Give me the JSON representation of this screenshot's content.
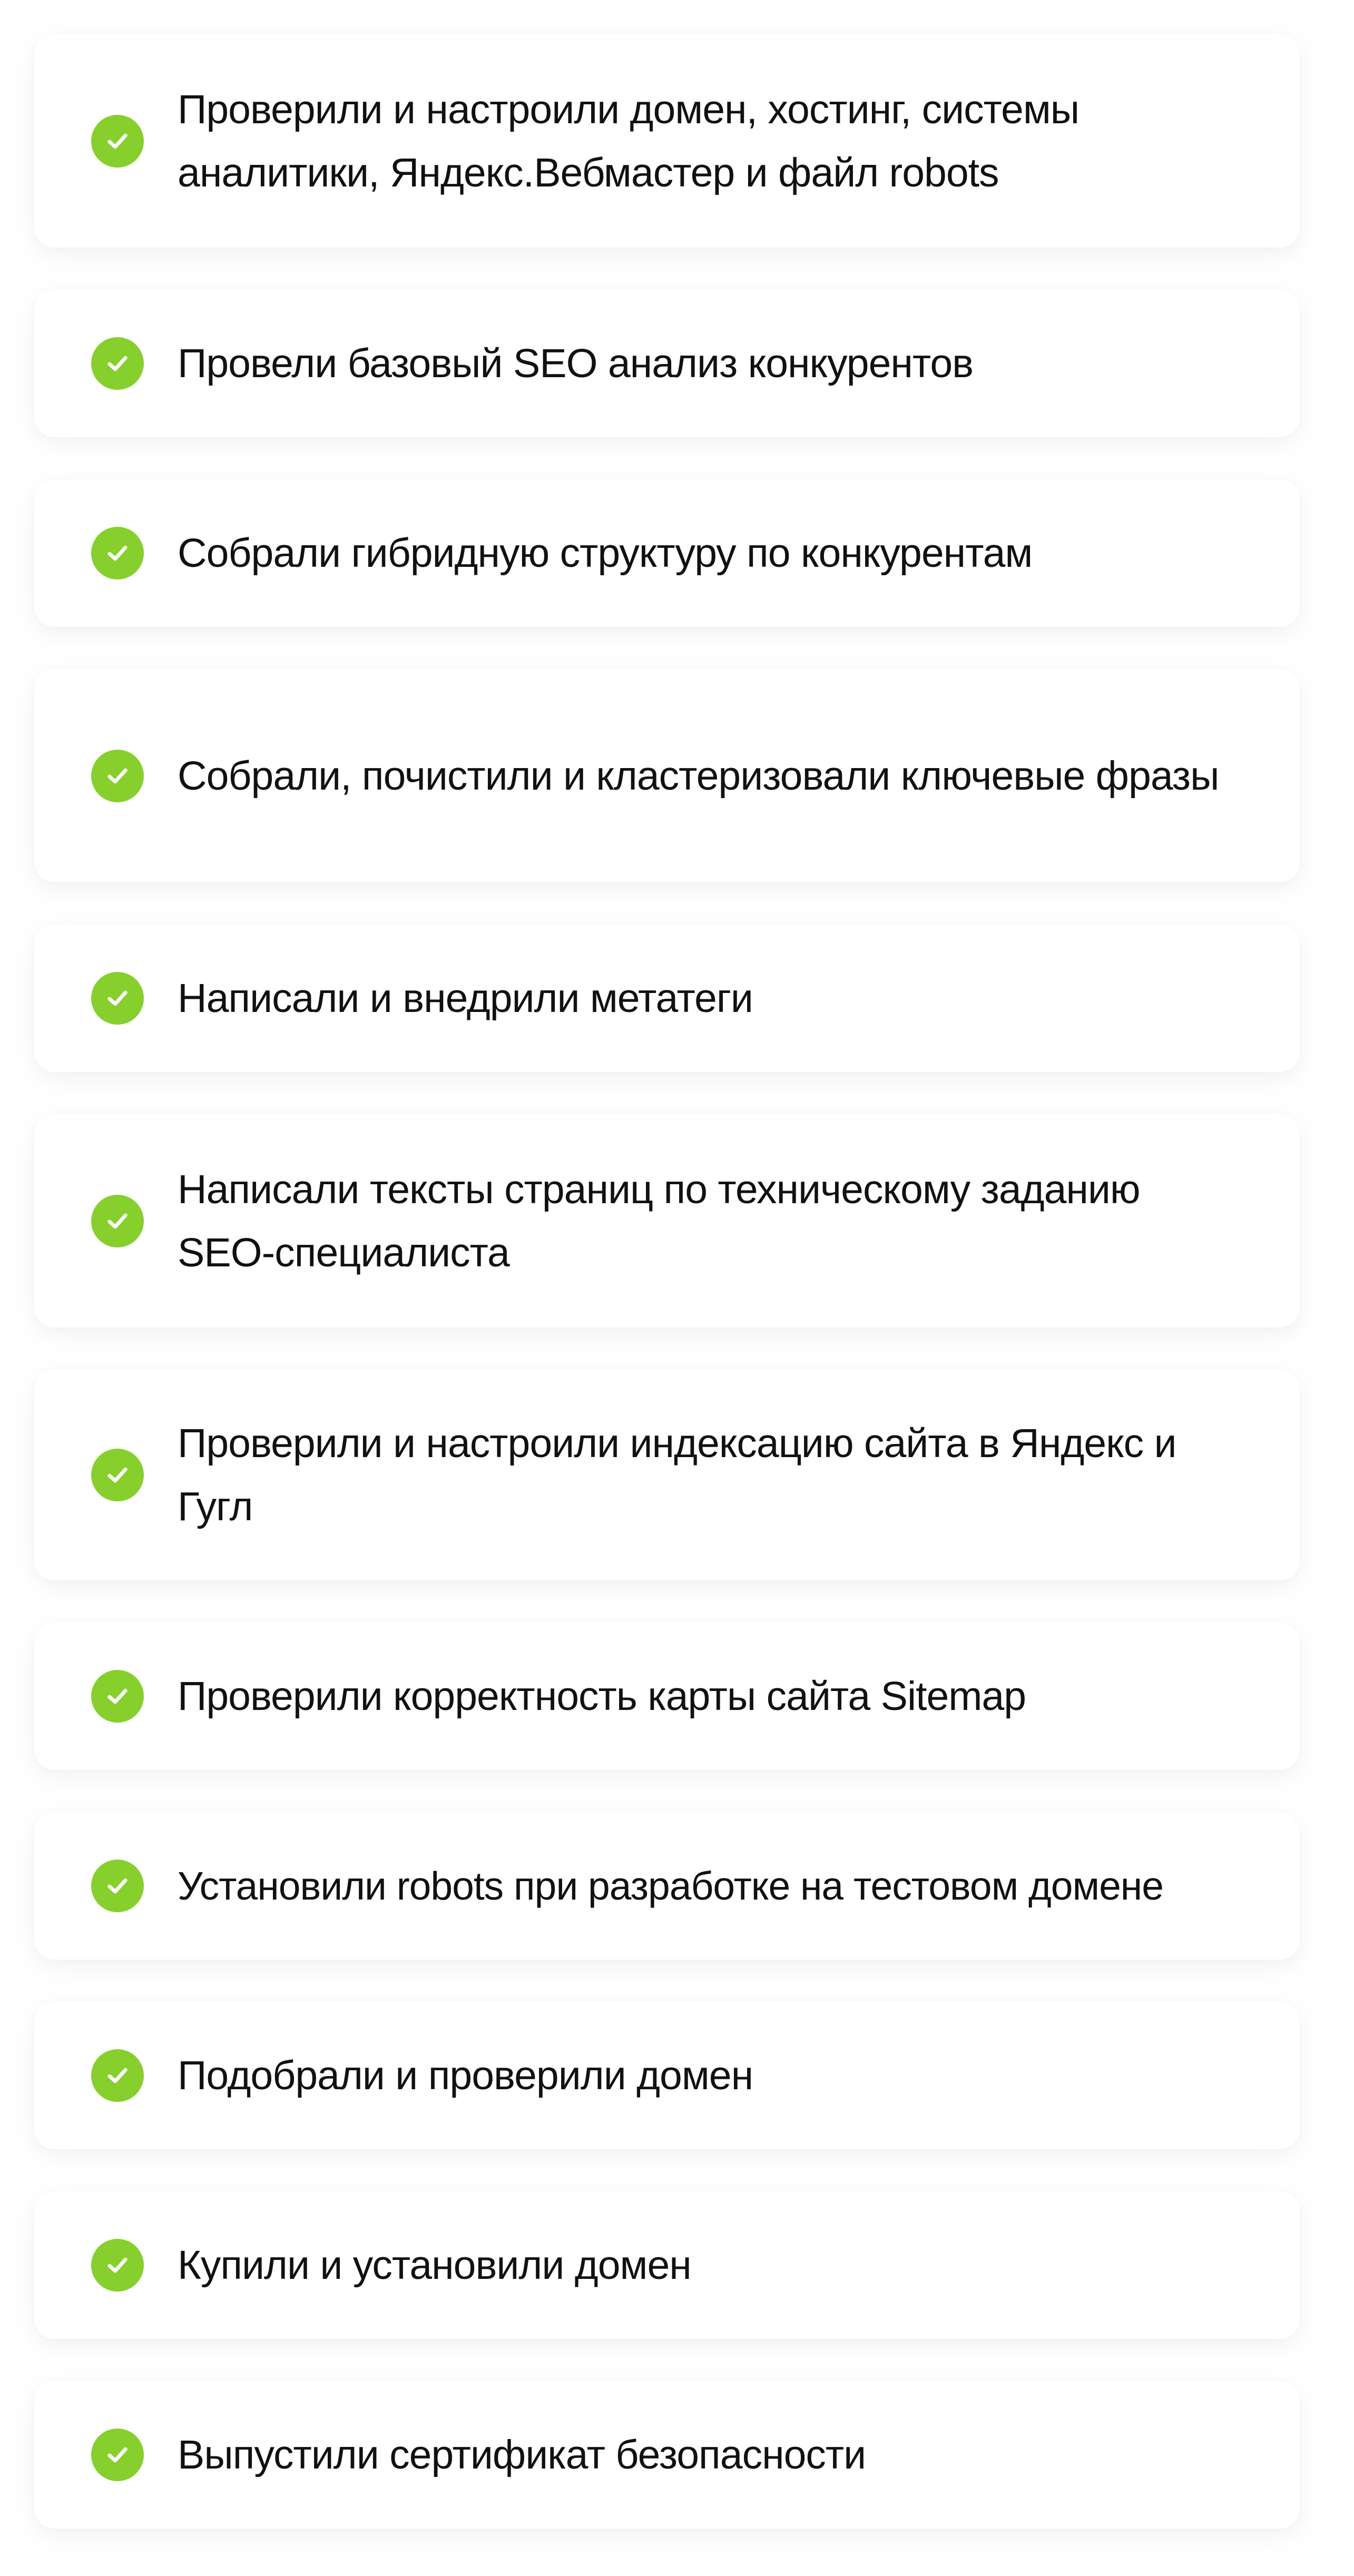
{
  "colors": {
    "check": "#86cf2d",
    "text": "#111111",
    "card": "#ffffff"
  },
  "icon": "checkmark-circle-icon",
  "items": [
    {
      "label": "Проверили и настроили домен, хостинг, системы аналитики, Яндекс.Вебмастер и файл robots"
    },
    {
      "label": "Провели базовый SEO анализ конкурентов"
    },
    {
      "label": "Собрали гибридную структуру по конкурентам"
    },
    {
      "label": "Собрали, почистили и кластеризовали ключевые фразы"
    },
    {
      "label": "Написали и внедрили метатеги"
    },
    {
      "label": "Написали тексты страниц по техническому заданию SEO-специалиста"
    },
    {
      "label": "Проверили и настроили индексацию сайта в Яндекс и Гугл"
    },
    {
      "label": "Проверили корректность карты сайта Sitemap"
    },
    {
      "label": "Установили robots при разработке на тестовом домене"
    },
    {
      "label": "Подобрали и проверили домен"
    },
    {
      "label": "Купили и установили домен"
    },
    {
      "label": "Выпустили сертификат безопасности"
    }
  ]
}
